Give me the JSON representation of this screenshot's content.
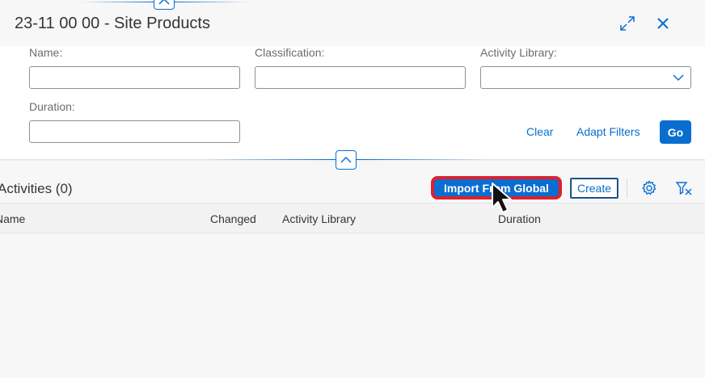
{
  "header": {
    "title": "23-11 00 00 - Site Products"
  },
  "filters": {
    "name": {
      "label": "Name:",
      "value": "",
      "placeholder": ""
    },
    "classification": {
      "label": "Classification:",
      "value": "",
      "placeholder": ""
    },
    "activity_library": {
      "label": "Activity Library:",
      "value": ""
    },
    "duration": {
      "label": "Duration:",
      "value": "",
      "placeholder": ""
    },
    "clear_label": "Clear",
    "adapt_filters_label": "Adapt Filters",
    "go_label": "Go"
  },
  "toolbar": {
    "title": "Activities (0)",
    "import_label": "Import From Global",
    "create_label": "Create"
  },
  "table": {
    "columns": [
      "Name",
      "Changed",
      "Activity Library",
      "Duration"
    ],
    "rows": []
  },
  "colors": {
    "accent": "#0a6ed1",
    "highlight": "#e0202a"
  },
  "icons": {
    "expand": "fullscreen-icon",
    "close": "close-icon",
    "settings": "gear-icon",
    "clear_filter": "filter-clear-icon"
  }
}
